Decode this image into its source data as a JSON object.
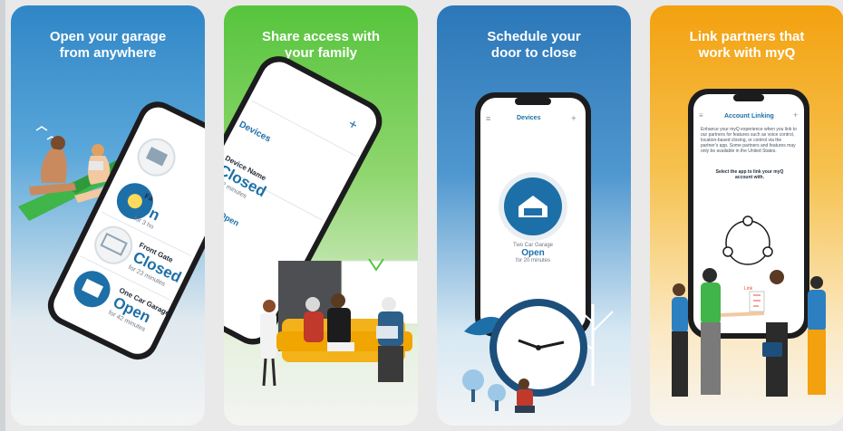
{
  "cards": [
    {
      "title_lines": [
        "Open your garage",
        "from anywhere"
      ],
      "devices": [
        {
          "name": "",
          "status": "",
          "duration": ""
        },
        {
          "name": "Fa",
          "status": "On",
          "duration": "for 3 ho"
        },
        {
          "name": "Front Gate",
          "status": "Closed",
          "duration": "for 23 minutes"
        },
        {
          "name": "One Car Garage",
          "status": "Open",
          "duration": "for 42 minutes"
        }
      ]
    },
    {
      "title_lines": [
        "Share access with",
        "your family"
      ],
      "screen_title": "Devices",
      "device_name": "Device Name",
      "device_status": "Closed",
      "device_duration": "for 2 minutes",
      "device2_status": "Open"
    },
    {
      "title_lines": [
        "Schedule your",
        "door to close"
      ],
      "screen_title": "Devices",
      "device_name": "Two Car Garage",
      "device_status": "Open",
      "device_duration": "for 20 minutes"
    },
    {
      "title_lines": [
        "Link partners that",
        "work with myQ"
      ],
      "screen_title": "Account Linking",
      "body_text": "Enhance your myQ experience when you link to our partners for features such as voice control, location-based closing, or control via the partner's app. Some partners and features may only be available in the United States.",
      "select_text": "Select the app to link your myQ account with.",
      "link_label": "Link"
    }
  ],
  "colors": {
    "blue_accent": "#1d6fa8",
    "green_accent": "#56c43c",
    "orange_accent": "#f3a10f",
    "phone_frame": "#1c1c1e"
  }
}
